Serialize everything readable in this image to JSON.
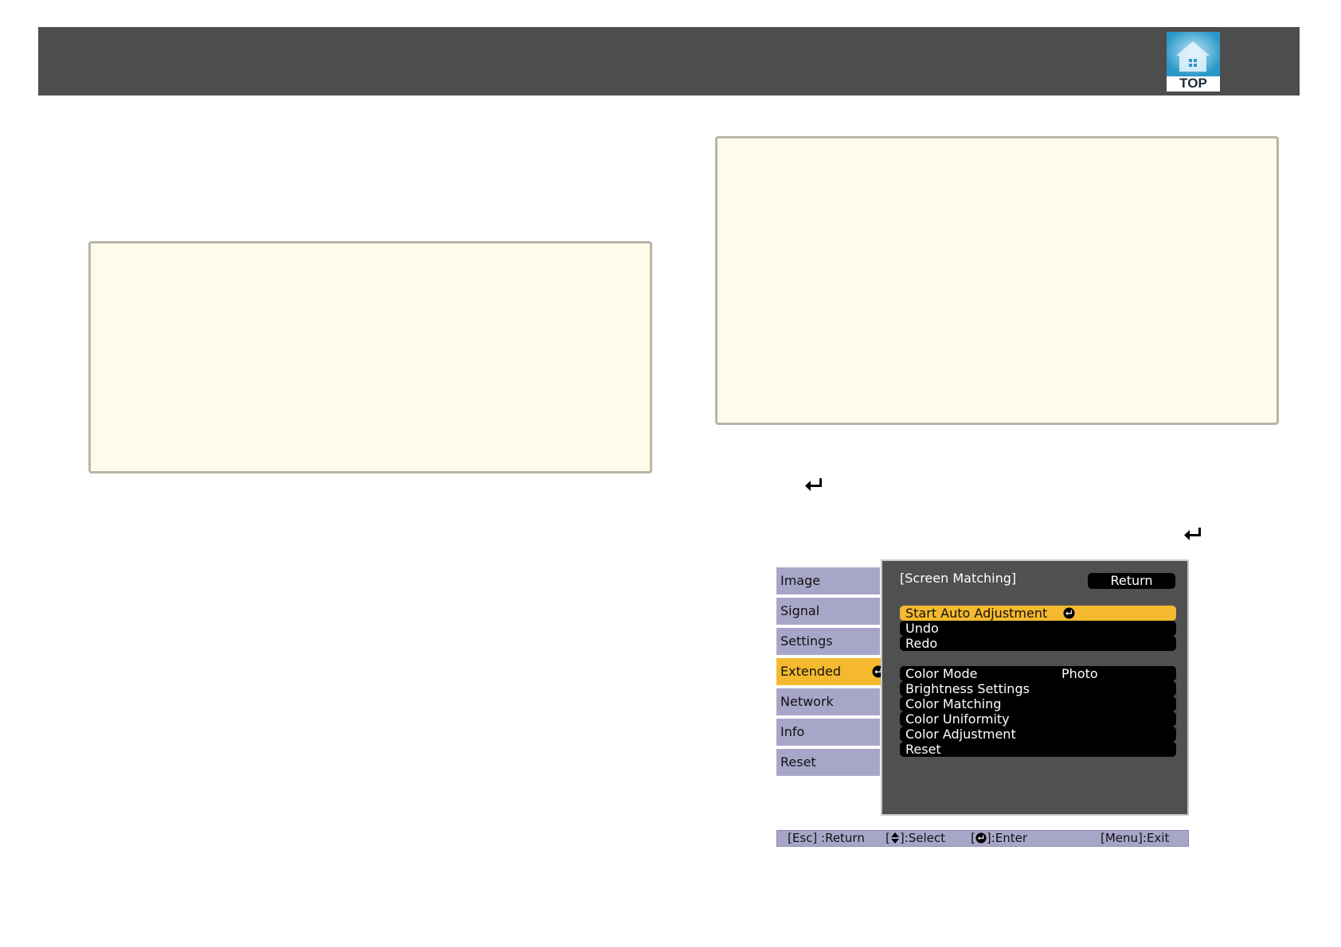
{
  "header": {
    "top_button_label": "TOP",
    "top_icon": "home-icon",
    "bar_color": "#4d4d4d"
  },
  "note_box_color": "#fefbea",
  "enter_icon": "enter-icon",
  "projector_menu": {
    "tabs": [
      {
        "label": "Image"
      },
      {
        "label": "Signal"
      },
      {
        "label": "Settings"
      },
      {
        "label": "Extended",
        "active": true
      },
      {
        "label": "Network"
      },
      {
        "label": "Info"
      },
      {
        "label": "Reset"
      }
    ],
    "panel": {
      "title": "[Screen Matching]",
      "return_label": "Return",
      "items": [
        {
          "label": "Start Auto Adjustment",
          "selected": true
        },
        {
          "label": "Undo"
        },
        {
          "label": "Redo"
        },
        {
          "label": "Color Mode",
          "value": "Photo"
        },
        {
          "label": "Brightness Settings"
        },
        {
          "label": "Color Matching"
        },
        {
          "label": "Color Uniformity"
        },
        {
          "label": "Color Adjustment"
        },
        {
          "label": "Reset"
        }
      ]
    },
    "status": {
      "esc": "[Esc] :Return",
      "select_prefix": "[",
      "select_suffix": "]:Select",
      "enter_prefix": "[",
      "enter_suffix": "]:Enter",
      "menu": "[Menu]:Exit"
    },
    "colors": {
      "tab": "#a8a6c8",
      "highlight": "#f4b92e",
      "panel": "#505050"
    }
  }
}
